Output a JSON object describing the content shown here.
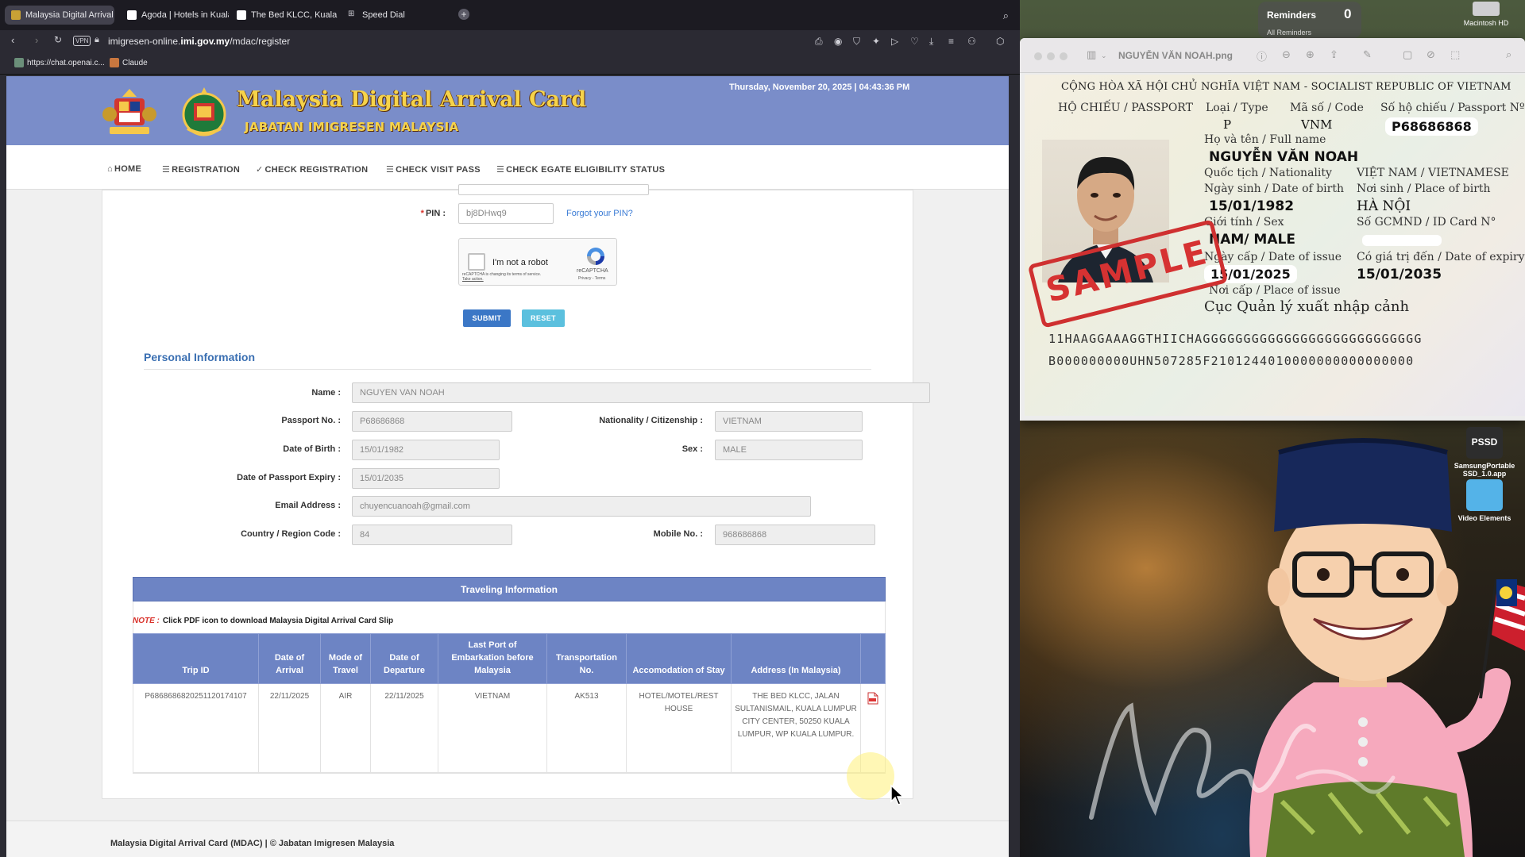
{
  "browser": {
    "tabs": [
      {
        "label": "Malaysia Digital Arrival C",
        "active": true
      },
      {
        "label": "Agoda | Hotels in Kuala L",
        "active": false
      },
      {
        "label": "The Bed KLCC, Kuala Lu",
        "active": false
      },
      {
        "label": "Speed Dial",
        "active": false
      }
    ],
    "url_prefix": "imigresen-online.",
    "url_domain": "imi.gov.my",
    "url_path": "/mdac/register",
    "vpn_label": "VPN",
    "bookmarks": [
      {
        "label": "https://chat.openai.c..."
      },
      {
        "label": "Claude"
      }
    ]
  },
  "site": {
    "title": "Malaysia Digital Arrival Card",
    "subtitle": "JABATAN IMIGRESEN MALAYSIA",
    "datetime": "Thursday, November 20, 2025 | 04:43:36 PM",
    "nav": [
      {
        "label": "HOME",
        "icon": "home-icon"
      },
      {
        "label": "REGISTRATION",
        "icon": "list-icon"
      },
      {
        "label": "CHECK REGISTRATION",
        "icon": "check-icon"
      },
      {
        "label": "CHECK VISIT PASS",
        "icon": "list-icon"
      },
      {
        "label": "CHECK EGATE ELIGIBILITY STATUS",
        "icon": "list-icon"
      }
    ],
    "footer": "Malaysia Digital Arrival Card (MDAC) | © Jabatan Imigresen Malaysia"
  },
  "form": {
    "pin_label": "PIN :",
    "pin_value": "bj8DHwq9",
    "forgot_pin": "Forgot your PIN?",
    "recaptcha": {
      "label": "I'm not a robot",
      "brand": "reCAPTCHA",
      "privacy": "Privacy - Terms",
      "notice_line1": "reCAPTCHA is changing its terms of service.",
      "notice_line2": "Take action."
    },
    "submit_label": "SUBMIT",
    "reset_label": "RESET"
  },
  "personal": {
    "heading": "Personal Information",
    "name_label": "Name :",
    "name": "NGUYEN VAN NOAH",
    "passport_label": "Passport No. :",
    "passport": "P68686868",
    "nationality_label": "Nationality / Citizenship :",
    "nationality": "VIETNAM",
    "dob_label": "Date of Birth :",
    "dob": "15/01/1982",
    "sex_label": "Sex :",
    "sex": "MALE",
    "expiry_label": "Date of Passport Expiry :",
    "expiry": "15/01/2035",
    "email_label": "Email Address :",
    "email": "chuyencuanoah@gmail.com",
    "country_code_label": "Country / Region Code :",
    "country_code": "84",
    "mobile_label": "Mobile No. :",
    "mobile": "968686868"
  },
  "travel": {
    "heading": "Traveling Information",
    "note_key": "NOTE :",
    "note_text": "Click PDF icon to download Malaysia Digital Arrival Card Slip",
    "columns": [
      "Trip ID",
      "Date of Arrival",
      "Mode of Travel",
      "Date of Departure",
      "Last Port of Embarkation before Malaysia",
      "Transportation No.",
      "Accomodation of Stay",
      "Address (In Malaysia)",
      ""
    ],
    "rows": [
      {
        "trip_id": "P6868686820251120174107",
        "arrival": "22/11/2025",
        "mode": "AIR",
        "departure": "22/11/2025",
        "port": "VIETNAM",
        "transport_no": "AK513",
        "accommodation": "HOTEL/MOTEL/REST HOUSE",
        "address": "THE BED KLCC, JALAN SULTANISMAIL, KUALA LUMPUR CITY CENTER, 50250 KUALA LUMPUR, WP KUALA LUMPUR."
      }
    ]
  },
  "desktop": {
    "reminders_title": "Reminders",
    "reminders_count": "0",
    "reminders_sub": "All Reminders",
    "drive_label": "Macintosh HD",
    "preview_title": "NGUYỄN VĂN NOAH.png",
    "icons": [
      {
        "label": "SamsungPortable SSD_1.0.app",
        "badge": "PSSD"
      },
      {
        "label": "Video Elements"
      }
    ]
  },
  "passport_image": {
    "header": "CỘNG HÒA XÃ HỘI CHỦ NGHĨA VIỆT NAM - SOCIALIST REPUBLIC OF VIETNAM",
    "passport_label": "HỘ CHIẾU / PASSPORT",
    "type_label": "Loại / Type",
    "type": "P",
    "code_label": "Mã số / Code",
    "code": "VNM",
    "number_label": "Số hộ chiếu / Passport Nº",
    "number": "P68686868",
    "fullname_label": "Họ và tên / Full name",
    "fullname": "NGUYỄN VĂN NOAH",
    "nationality_label": "Quốc tịch / Nationality",
    "nationality": "VIỆT NAM / VIETNAMESE",
    "dob_label": "Ngày sinh / Date of birth",
    "dob": "15/01/1982",
    "pob_label": "Nơi sinh / Place of birth",
    "pob": "HÀ NỘI",
    "sex_label": "Giới tính / Sex",
    "sex": "NAM/ MALE",
    "id_label": "Số GCMND / ID Card N°",
    "issue_label": "Ngày cấp / Date of issue",
    "issue": "15/01/2025",
    "expiry_label": "Có giá trị đến / Date of expiry",
    "expiry": "15/01/2035",
    "place_issue_label": "Nơi cấp / Place of issue",
    "place_issue": "Cục Quản lý xuất nhập cảnh",
    "stamp": "SAMPLE",
    "mrz1": "11HAAGGAAAGGTHIICHAGGGGGGGGGGGGGGGGGGGGGGGGGGG",
    "mrz2": "B000000000UHN507285F2101244010000000000000000"
  },
  "colors": {
    "header_bg": "#7a8dc9",
    "title_gold": "#f6d34a",
    "primary_blue": "#3b77c6",
    "reset_blue": "#5bc0de",
    "table_header": "#6d84c4",
    "required_red": "#d9322b",
    "stamp_red": "#d63232"
  }
}
